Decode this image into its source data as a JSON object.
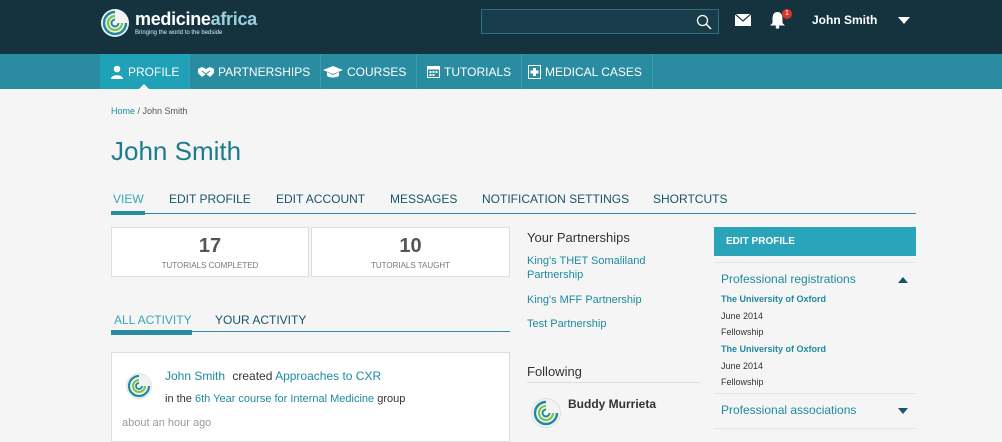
{
  "brand": {
    "name_main": "medicine",
    "name_accent": "africa",
    "tagline": "Bringing the world to the bedside"
  },
  "header": {
    "search_placeholder": "",
    "user_name": "John Smith",
    "notification_count": "1"
  },
  "nav": [
    {
      "label": "PROFILE",
      "icon": "person-icon"
    },
    {
      "label": "PARTNERSHIPS",
      "icon": "handshake-icon"
    },
    {
      "label": "COURSES",
      "icon": "graduation-cap-icon"
    },
    {
      "label": "TUTORIALS",
      "icon": "calendar-icon"
    },
    {
      "label": "MEDICAL CASES",
      "icon": "case-icon"
    }
  ],
  "breadcrumb": {
    "home": "Home",
    "current": " / John Smith"
  },
  "page_title": "John Smith",
  "profile_tabs": [
    "VIEW",
    "EDIT PROFILE",
    "EDIT ACCOUNT",
    "MESSAGES",
    "NOTIFICATION SETTINGS",
    "SHORTCUTS"
  ],
  "stats": [
    {
      "value": "17",
      "label": "TUTORIALS COMPLETED"
    },
    {
      "value": "10",
      "label": "TUTORIALS TAUGHT"
    }
  ],
  "activity_tabs": [
    "ALL ACTIVITY",
    "YOUR ACTIVITY"
  ],
  "activity": {
    "actor": "John Smith",
    "verb": "created",
    "object": "Approaches to CXR",
    "prefix": "in the",
    "group": "6th Year course for Internal Medicine",
    "suffix": "group",
    "time": "about an hour ago"
  },
  "partnerships": {
    "title": "Your Partnerships",
    "items": [
      "King's THET Somaliland Partnership",
      "King's MFF Partnership",
      "Test Partnership"
    ]
  },
  "following": {
    "title": "Following",
    "name": "Buddy Murrieta"
  },
  "sidebar": {
    "header": "EDIT PROFILE",
    "registrations_title": "Professional registrations",
    "registrations": [
      {
        "org": "The University of Oxford",
        "date": "June 2014",
        "type": "Fellowship"
      },
      {
        "org": "The University of Oxford",
        "date": "June 2014",
        "type": "Fellowship"
      }
    ],
    "associations_title": "Professional associations"
  },
  "colors": {
    "topbar": "#14333f",
    "navbar": "#2a8ca0",
    "accent": "#2aa4b8",
    "link": "#1e8aa0"
  }
}
